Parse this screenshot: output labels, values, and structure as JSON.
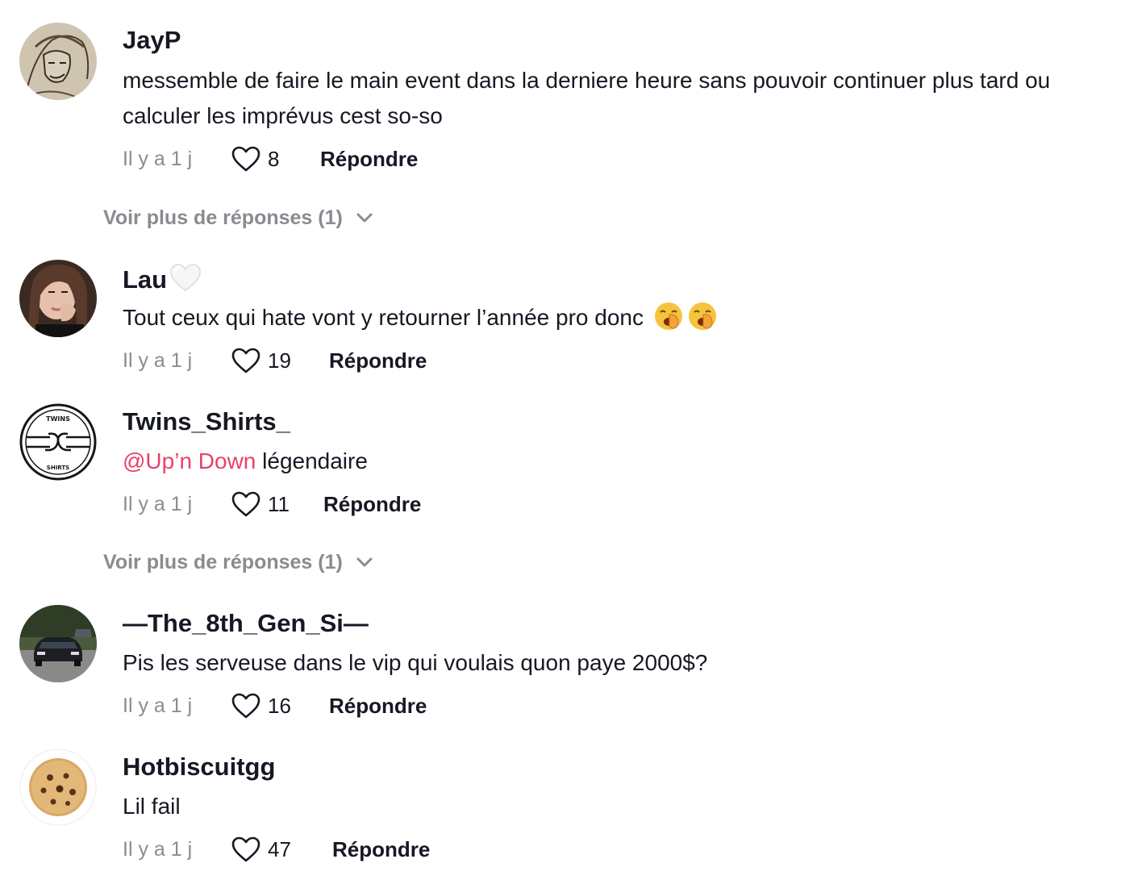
{
  "comments": [
    {
      "username": "JayP",
      "text": "messemble de faire le main event dans la derniere heure sans pouvoir continuer plus tard ou calculer les imprévus cest so-so",
      "time": "Il y a 1 j",
      "likes": "8",
      "reply": "Répondre",
      "more_replies": "Voir plus de réponses (1)"
    },
    {
      "username": "Lau",
      "username_emoji": "white-heart-icon",
      "text": "Tout ceux qui hate vont y retourner l’année pro donc",
      "text_emojis": [
        "yawning-face-icon",
        "yawning-face-icon"
      ],
      "time": "Il y a 1 j",
      "likes": "19",
      "reply": "Répondre"
    },
    {
      "username": "Twins_Shirts_",
      "mention": "@Up’n Down",
      "text": " légendaire",
      "avatar_text_top": "TWINS",
      "avatar_text_bottom": "SHIRTS",
      "time": "Il y a 1 j",
      "likes": "11",
      "reply": "Répondre",
      "more_replies": "Voir plus de réponses (1)"
    },
    {
      "username": "—The_8th_Gen_Si—",
      "text": "Pis les serveuse dans le vip qui voulais quon paye 2000$?",
      "time": "Il y a 1 j",
      "likes": "16",
      "reply": "Répondre"
    },
    {
      "username": "Hotbiscuitgg",
      "text": "Lil fail",
      "time": "Il y a 1 j",
      "likes": "47",
      "reply": "Répondre"
    }
  ],
  "icons": {
    "like": "heart-outline-icon",
    "expand": "chevron-down-icon"
  },
  "colors": {
    "text": "#161823",
    "muted": "#8a8b91",
    "mention": "#e8416a"
  }
}
